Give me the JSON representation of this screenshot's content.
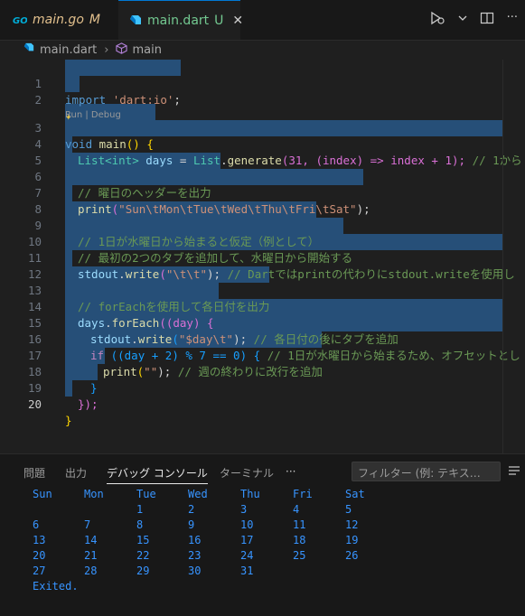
{
  "tabs": [
    {
      "name": "main.go",
      "status": "M",
      "icon": "go-icon"
    },
    {
      "name": "main.dart",
      "status": "U",
      "icon": "dart-icon"
    }
  ],
  "breadcrumb": {
    "file": "main.dart",
    "symbol": "main"
  },
  "code_lens": "Run | Debug",
  "active_line": "20",
  "line_numbers": [
    "1",
    "2",
    "3",
    "4",
    "5",
    "6",
    "7",
    "8",
    "9",
    "10",
    "11",
    "12",
    "13",
    "14",
    "15",
    "16",
    "17",
    "18",
    "19",
    "20"
  ],
  "code": {
    "l1": {
      "kw": "import",
      "str": "'dart:io'",
      "end": ";"
    },
    "l4": {
      "ty1": "List",
      "gen": "<int>",
      "v": "days",
      "eq": " = ",
      "ty2": "List",
      "dot": ".",
      "fn": "generate",
      "args": "(31, (index) => index + 1);",
      "cm": "// 1から"
    },
    "l6": "// 曜日のヘッダーを出力",
    "l7": {
      "fn": "print",
      "str": "\"Sun\\tMon\\tTue\\tWed\\tThu\\tFri\\tSat\"",
      "end": ");"
    },
    "l9": "// 1日が水曜日から始まると仮定（例として）",
    "l10": "// 最初の2つのタブを追加して、水曜日から開始する",
    "l11": {
      "obj": "stdout",
      "fn": "write",
      "str": "\"\\t\\t\"",
      "end": ");",
      "cm": "// Dartではprintの代わりにstdout.writeを使用し"
    },
    "l13": "// forEachを使用して各日付を出力",
    "l14": {
      "obj": "days",
      "fn": "forEach",
      "rest": "((day) {"
    },
    "l15": {
      "obj": "stdout",
      "fn": "write",
      "str": "\"$day\\t\"",
      "end": ");",
      "cm": "// 各日付の後にタブを追加"
    },
    "l16": {
      "kw": "if",
      "cond": "((day + 2) % 7 == 0) {",
      "cm": "// 1日が水曜日から始まるため、オフセットとし"
    },
    "l17": {
      "fn": "print",
      "str": "\"\"",
      "end": ");",
      "cm": "// 週の終わりに改行を追加"
    },
    "l18": "}",
    "l19": "});",
    "l20": "}",
    "l3": {
      "kw": "void",
      "fn": "main",
      "rest": "() {"
    }
  },
  "panel": {
    "tabs": [
      "問題",
      "出力",
      "デバッグ コンソール",
      "ターミナル"
    ],
    "more": "···",
    "filter_placeholder": "フィルター (例: テキス…",
    "console_header": [
      "Sun",
      "Mon",
      "Tue",
      "Wed",
      "Thu",
      "Fri",
      "Sat"
    ],
    "console_rows": [
      [
        "",
        "",
        "1",
        "2",
        "3",
        "4",
        "5"
      ],
      [
        "6",
        "7",
        "8",
        "9",
        "10",
        "11",
        "12"
      ],
      [
        "13",
        "14",
        "15",
        "16",
        "17",
        "18",
        "19"
      ],
      [
        "20",
        "21",
        "22",
        "23",
        "24",
        "25",
        "26"
      ],
      [
        "27",
        "28",
        "29",
        "30",
        "31",
        "",
        ""
      ]
    ],
    "exited": "Exited."
  }
}
